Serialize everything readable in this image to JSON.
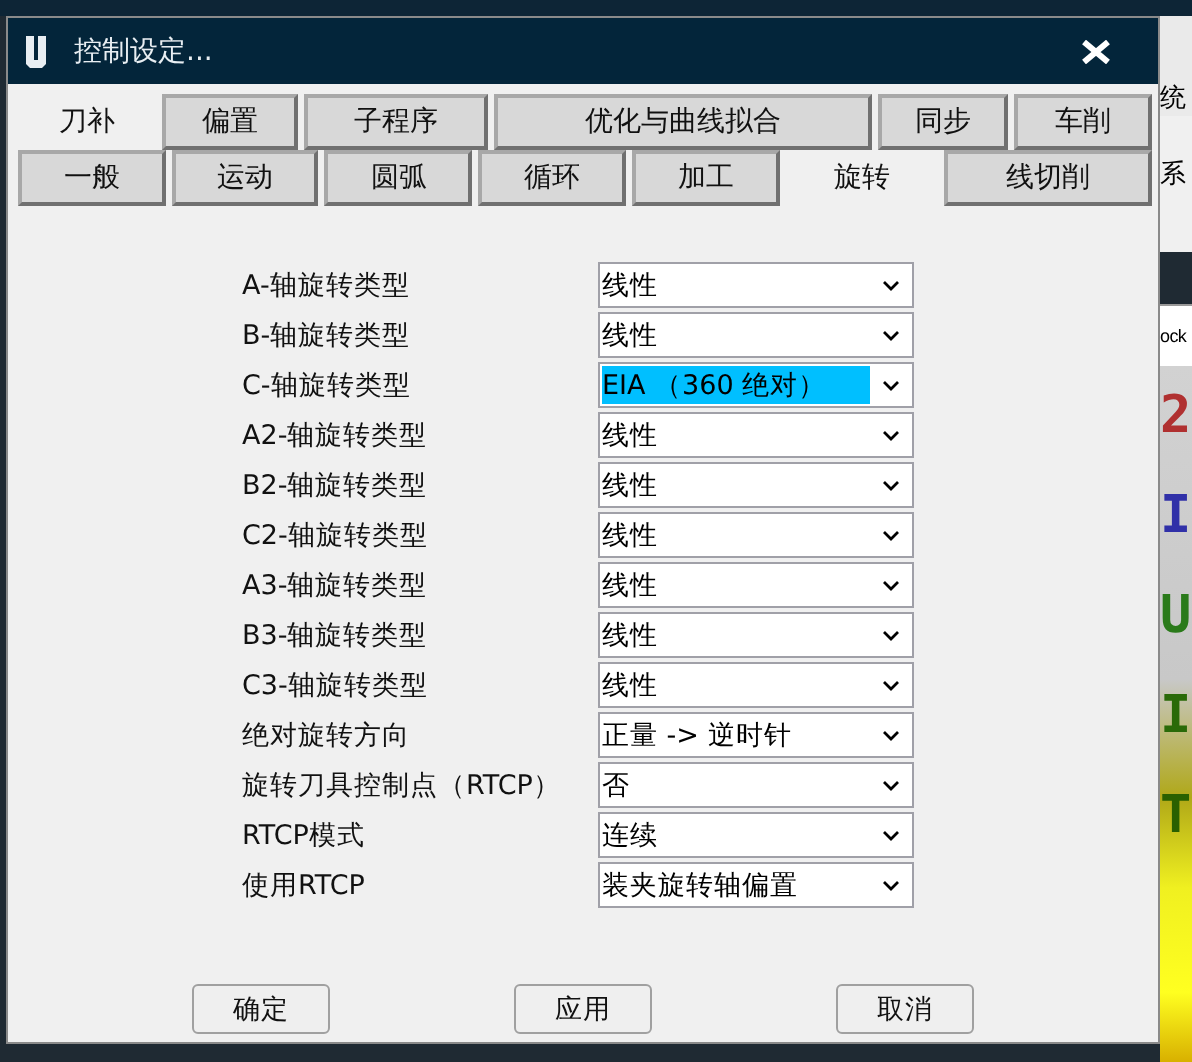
{
  "window": {
    "title": "控制设定..."
  },
  "tab_rows": [
    [
      {
        "label": "刀补",
        "selected": true
      },
      {
        "label": "偏置",
        "selected": false
      },
      {
        "label": "子程序",
        "selected": false
      },
      {
        "label": "优化与曲线拟合",
        "selected": false
      },
      {
        "label": "同步",
        "selected": false
      },
      {
        "label": "车削",
        "selected": false
      }
    ],
    [
      {
        "label": "一般",
        "selected": false
      },
      {
        "label": "运动",
        "selected": false
      },
      {
        "label": "圆弧",
        "selected": false
      },
      {
        "label": "循环",
        "selected": false
      },
      {
        "label": "加工",
        "selected": false
      },
      {
        "label": "旋转",
        "selected": true
      },
      {
        "label": "线切削",
        "selected": false
      }
    ]
  ],
  "fields": [
    {
      "label": "A-轴旋转类型",
      "value": "线性",
      "highlighted": false
    },
    {
      "label": "B-轴旋转类型",
      "value": "线性",
      "highlighted": false
    },
    {
      "label": "C-轴旋转类型",
      "value": "EIA （360 绝对）",
      "highlighted": true
    },
    {
      "label": "A2-轴旋转类型",
      "value": "线性",
      "highlighted": false
    },
    {
      "label": "B2-轴旋转类型",
      "value": "线性",
      "highlighted": false
    },
    {
      "label": "C2-轴旋转类型",
      "value": "线性",
      "highlighted": false
    },
    {
      "label": "A3-轴旋转类型",
      "value": "线性",
      "highlighted": false
    },
    {
      "label": "B3-轴旋转类型",
      "value": "线性",
      "highlighted": false
    },
    {
      "label": "C3-轴旋转类型",
      "value": "线性",
      "highlighted": false
    },
    {
      "label": "绝对旋转方向",
      "value": "正量 -> 逆时针",
      "highlighted": false
    },
    {
      "label": "旋转刀具控制点（RTCP）",
      "value": "否",
      "highlighted": false
    },
    {
      "label": "RTCP模式",
      "value": "连续",
      "highlighted": false
    },
    {
      "label": "使用RTCP",
      "value": "装夹旋转轴偏置",
      "highlighted": false
    }
  ],
  "buttons": [
    "确定",
    "应用",
    "取消"
  ],
  "background": {
    "texts": [
      "统",
      "系",
      "ock"
    ],
    "viewport_labels": [
      {
        "text": "2",
        "color": "#b03030"
      },
      {
        "text": "I",
        "color": "#3030a8"
      },
      {
        "text": "U",
        "color": "#2a7a1a"
      },
      {
        "text": "I",
        "color": "#2a6a08"
      },
      {
        "text": "T",
        "color": "#2a6000"
      }
    ]
  }
}
